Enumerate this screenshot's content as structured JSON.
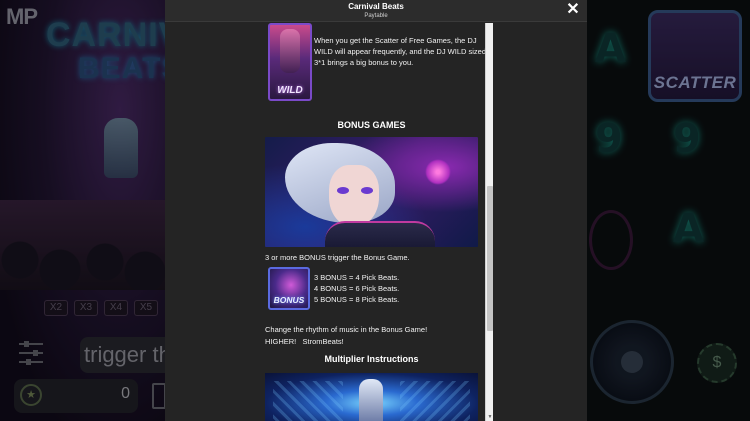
{
  "modal": {
    "title": "Carnival Beats",
    "subtitle": "Paytable",
    "close_label": "✕"
  },
  "wild": {
    "symbol_label": "WILD",
    "description": "When you get the Scatter of Free Games, the DJ WILD will appear frequently, and the DJ WILD sized 3*1 brings a big bonus to you."
  },
  "bonus_games": {
    "heading": "BONUS GAMES",
    "trigger_text": "3 or more BONUS trigger the Bonus Game.",
    "symbol_label": "BONUS",
    "rules": [
      "3 BONUS = 4 Pick Beats.",
      "4 BONUS = 6 Pick Beats.",
      "5 BONUS = 8 Pick Beats."
    ],
    "rhythm_line1": "Change the rhythm of music in the Bonus Game!",
    "rhythm_line2": "HIGHER!   StromBeats!"
  },
  "multiplier": {
    "heading": "Multiplier Instructions"
  },
  "background": {
    "logo": "MP",
    "title_line1": "CARNIV",
    "title_line2": "BEATS",
    "multipliers": [
      "X2",
      "X3",
      "X4",
      "X5"
    ],
    "bet_prompt": "trigger the",
    "win_value": "0",
    "scatter_label": "SCATTER",
    "reel_symbols": [
      "A",
      "9",
      "A",
      "9",
      "A"
    ],
    "icons": [
      "settings-sliders-icon",
      "trophy-icon",
      "bag-icon",
      "vinyl-disc-icon",
      "chip-icon",
      "close-icon"
    ]
  },
  "colors": {
    "modal_bg": "#242424",
    "header_bg": "#2c2c2c",
    "text": "#f2f2f2",
    "accent_purple": "#7a4ac8",
    "accent_blue": "#5a6ae0"
  },
  "scroll": {
    "position_fraction": 0.41
  }
}
